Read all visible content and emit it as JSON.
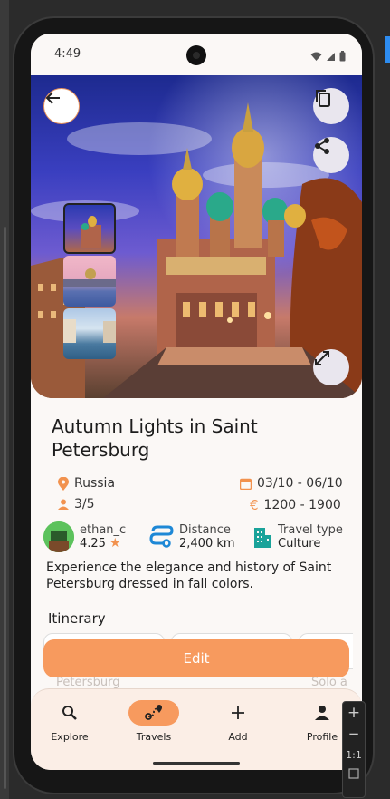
{
  "status_bar": {
    "time": "4:49"
  },
  "trip": {
    "title": "Autumn Lights in Saint Petersburg",
    "country": "Russia",
    "dates": "03/10 - 06/10",
    "people": "3/5",
    "price": "1200 - 1900",
    "description": "Experience the elegance and history of Saint Petersburg dressed in fall colors."
  },
  "author": {
    "username": "ethan_c",
    "rating": "4.25"
  },
  "distance": {
    "label": "Distance",
    "value": "2,400 km"
  },
  "travel_type": {
    "label": "Travel type",
    "value": "Culture"
  },
  "itinerary": {
    "title": "Itinerary",
    "faded_left": "Petersburg",
    "faded_right": "Solo a"
  },
  "actions": {
    "edit_label": "Edit"
  },
  "nav": {
    "items": [
      {
        "label": "Explore",
        "icon": "search-icon"
      },
      {
        "label": "Travels",
        "icon": "route-icon",
        "active": true
      },
      {
        "label": "Add",
        "icon": "plus-icon"
      },
      {
        "label": "Profile",
        "icon": "person-icon"
      }
    ]
  },
  "emulator_toolbar": {
    "plus": "+",
    "minus": "−",
    "ratio": "1:1"
  },
  "colors": {
    "accent": "#f79a5e",
    "teal": "#1aa39a",
    "blue": "#2d8cf0"
  }
}
